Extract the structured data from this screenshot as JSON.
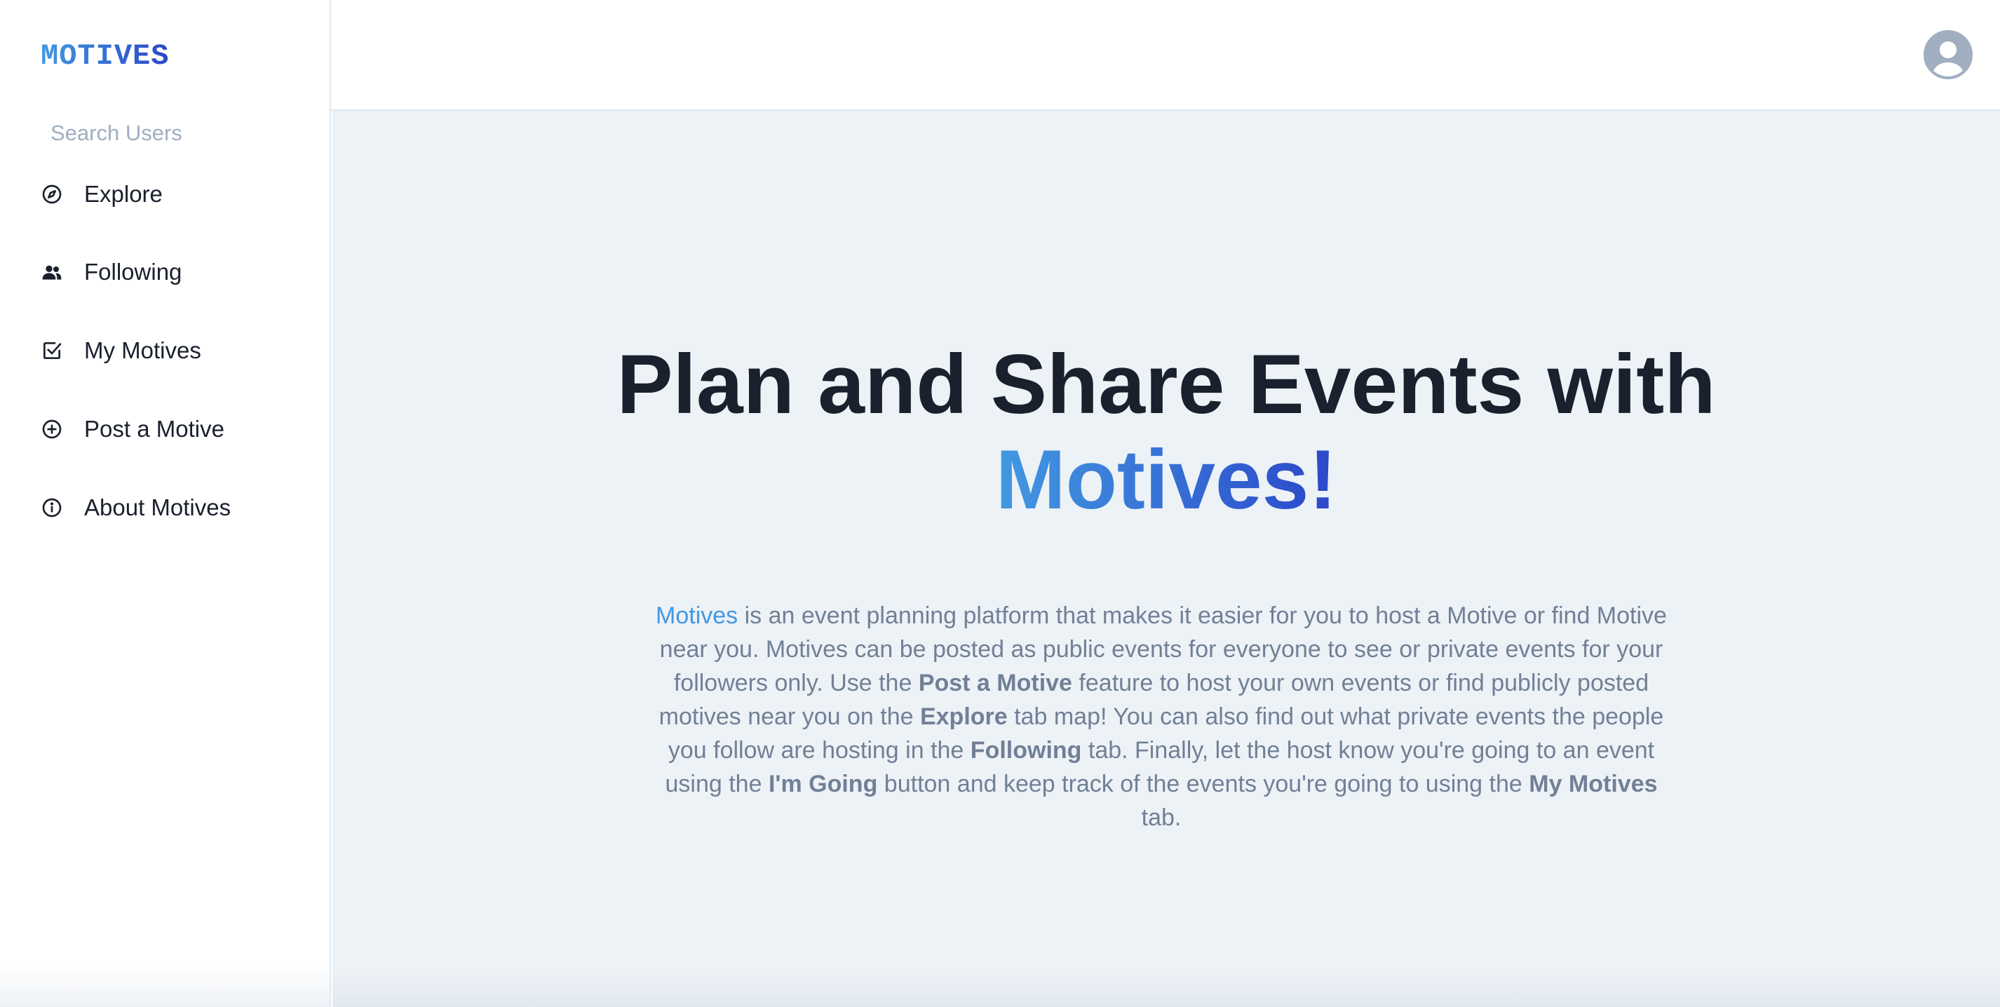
{
  "sidebar": {
    "logo": "MOTIVES",
    "search_placeholder": "Search Users",
    "items": [
      {
        "label": "Explore",
        "icon": "compass-icon"
      },
      {
        "label": "Following",
        "icon": "users-icon"
      },
      {
        "label": "My Motives",
        "icon": "check-square-icon"
      },
      {
        "label": "Post a Motive",
        "icon": "plus-circle-icon"
      },
      {
        "label": "About Motives",
        "icon": "info-icon"
      }
    ]
  },
  "header": {
    "avatar_icon": "user-avatar-icon"
  },
  "hero": {
    "title_line1": "Plan and Share Events with",
    "title_line2": "Motives!",
    "description": {
      "brand": "Motives",
      "p1": " is an event planning platform that makes it easier for you to host a Motive or find Motive near you. Motives can be posted as public events for everyone to see or private events for your followers only. Use the ",
      "b1": "Post a Motive",
      "p2": " feature to host your own events or find publicly posted motives near you on the ",
      "b2": "Explore",
      "p3": " tab map! You can also find out what private events the people you follow are hosting in the ",
      "b3": "Following",
      "p4": " tab. Finally, let the host know you're going to an event using the ",
      "b4": "I'm Going",
      "p5": " button and keep track of the events you're going to using the ",
      "b5": "My Motives",
      "p6": " tab."
    }
  },
  "colors": {
    "brand_start": "#4299e1",
    "brand_end": "#2b47c9",
    "main_bg": "#edf2f7",
    "text_dark": "#1a202c",
    "text_muted": "#718096"
  }
}
